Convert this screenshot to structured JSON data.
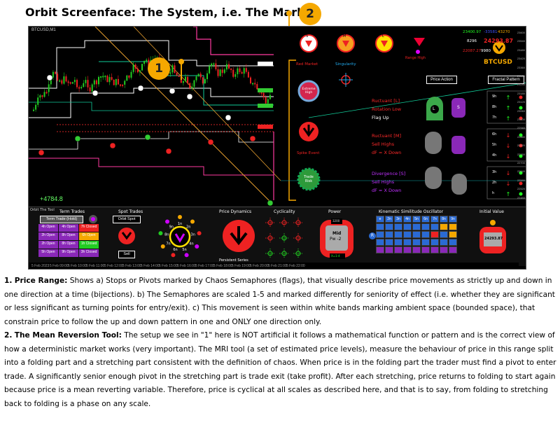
{
  "page": {
    "title": "Orbit Screenface: The System, i.e. The Market"
  },
  "badges": {
    "one": "1",
    "two": "2"
  },
  "chart": {
    "symbol_info": "BTCUSD,M1",
    "stat": "+4784.8",
    "price_labels": [
      "23600",
      "23540",
      "23480",
      "23420",
      "23360",
      "23300",
      "23240",
      "23180",
      "23120",
      "23060",
      "23000",
      "22940",
      "22880",
      "22820",
      "22760",
      "22700",
      "22640",
      "22580",
      "22520",
      "22460"
    ],
    "time_labels": [
      "5 Feb 2023",
      "5 Feb 09:00",
      "5 Feb 10:00",
      "5 Feb 11:00",
      "5 Feb 12:00",
      "5 Feb 13:00",
      "5 Feb 14:00",
      "5 Feb 15:00",
      "5 Feb 16:00",
      "5 Feb 17:00",
      "5 Feb 18:00",
      "5 Feb 19:00",
      "5 Feb 20:00",
      "5 Feb 21:00",
      "5 Feb 22:00"
    ]
  },
  "signals": {
    "red_market": "Red Market",
    "singularity": "Singularity",
    "extreme_high": "Extreme High",
    "range_high": "Range High",
    "spike_event": "Spike Event",
    "trade_risk": "Trade Risk",
    "price_action": "Price Action",
    "fractal_pattern": "Fractal Pattern",
    "dial_s": "S",
    "dial_m": "M",
    "dial_l": "L",
    "quote_1": "23400.97",
    "quote_2": "-33581",
    "quote_3": "43270",
    "quote_4": "8296",
    "quote_5": "24293.87",
    "quote_6": "22087.27",
    "quote_7": "9980",
    "symbol": "BTCUSD",
    "rows": [
      {
        "l1": "Ructuant [L]",
        "l2": "Rotation Low",
        "l3": "Flag Up",
        "color": "#ff2a2a"
      },
      {
        "l1": "Ructuant [M]",
        "l2": "Sell Highs",
        "l3": "dF = X Down",
        "color": "#ff2a2a"
      },
      {
        "l1": "Divergence [S]",
        "l2": "Sell Highs",
        "l3": "dF = X Down",
        "color": "#c030ff"
      }
    ],
    "pill_l": "L",
    "pill_s": "S",
    "tf": [
      "9h",
      "8h",
      "7h",
      "6h",
      "5h",
      "4h",
      "3h",
      "2h",
      "h"
    ]
  },
  "bottom": {
    "orbit_tool": "Orbit The Tool",
    "term_trades": "Term Trades",
    "term_trade_hold": "Term Trade (Hold)",
    "term_cells": [
      "4h Open",
      "4h Open",
      "7h Closed",
      "2h Open",
      "8h Open",
      "6h Open",
      "2h Open",
      "8h Open",
      "1h Closed",
      "5h Open",
      "9h Open",
      "3h Closed"
    ],
    "spot_trades": "Spot Trades",
    "orbit_spot": "Orbit Spot",
    "sell": "Sell",
    "price_dynamics": "Price Dynamics",
    "persistent_series": "Persistent Series",
    "cyclicality": "Cyclicality",
    "power": "Power",
    "power_top": "3200",
    "power_mid": "Mid",
    "power_val": "Pw -2",
    "power_bottom": "X=1-4",
    "kinematic": "Kinematic Similitude Oscillator",
    "kin_labels": [
      "e",
      "2n",
      "3n",
      "4n",
      "5n",
      "6n",
      "7n",
      "8n",
      "9n"
    ],
    "kin_r": "R",
    "initial_value": "Initial Value",
    "initial_price": "24293.87",
    "orbit_labels": [
      "1n",
      "2n",
      "3n",
      "4n",
      "5n",
      "6n",
      "7n",
      "8n",
      "9n"
    ]
  },
  "notes": [
    {
      "num": "1.",
      "head": "Price Range:",
      "text": " Shows a) Stops or Pivots marked by Chaos Semaphores (flags), that visually describe price movements as strictly up and down in one direction at a time (bijections). b) The Semaphores are scaled 1-5 and marked differently for seniority of effect (i.e. whether they are significant or less significant as turning points for entry/exit). c) This movement is seen within white bands marking ambient space (bounded space), that constrain price to follow the up and down pattern in one and ONLY one direction only."
    },
    {
      "num": "2.",
      "head": "The Mean Reversion Tool:",
      "text": " The setup we see in \"1\" here is NOT artificial it follows a mathematical function or pattern and is the correct view of how a deterministic market works (very important). The MRI tool (a set of estimated price levels), measure the behaviour of price in this range split into a folding part and a stretching part consistent with the definition of chaos. When price is in the folding part the trader must find a pivot to enter trade. A significantly senior enough pivot in the stretching part is trade exit (take profit). After each stretching, price returns to folding to start again because price is a mean reverting variable. Therefore, price is cyclical at all scales as described here, and that is to say, from folding to stretching back to folding is a phase on any scale."
    }
  ]
}
